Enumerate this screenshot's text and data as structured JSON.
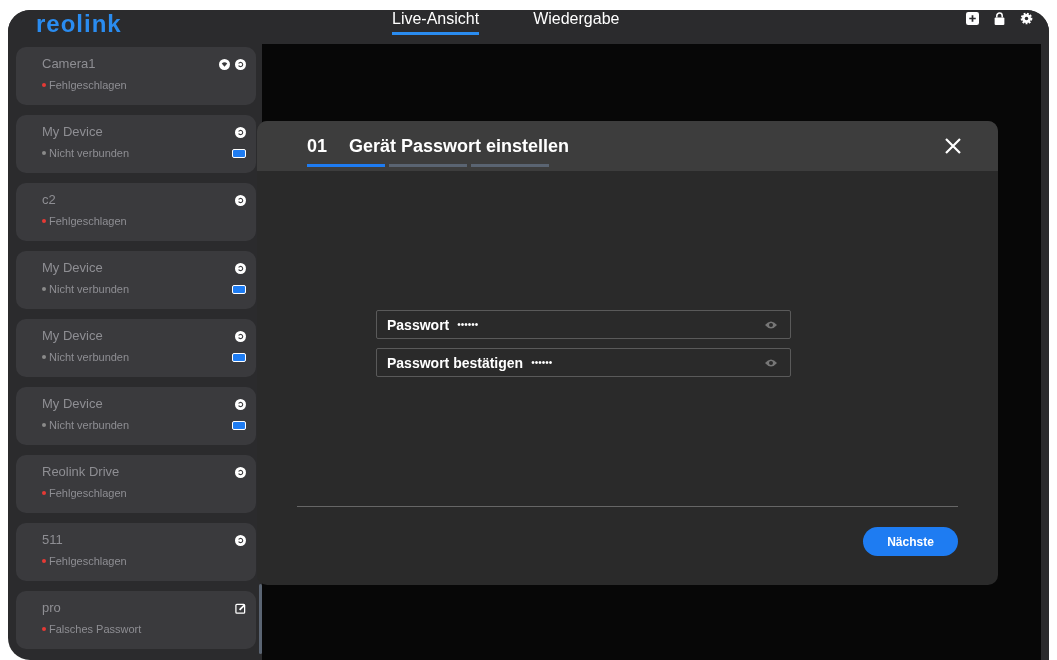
{
  "logo": "reolink",
  "tabs": [
    {
      "label": "Live-Ansicht",
      "selected": true
    },
    {
      "label": "Wiedergabe",
      "selected": false
    }
  ],
  "toolbar": [
    {
      "kind": "add"
    },
    {
      "kind": "lock"
    },
    {
      "kind": "settings"
    }
  ],
  "devices": [
    {
      "name": "Camera1",
      "status": "Fehlgeschlagen",
      "color": "#e53935",
      "icons": [
        {
          "kind": "wifi"
        },
        {
          "kind": "refresh"
        }
      ],
      "battery": false
    },
    {
      "name": "My Device",
      "status": "Nicht verbunden",
      "color": "#8a8a8a",
      "icons": [
        {
          "kind": "refresh"
        }
      ],
      "battery": true
    },
    {
      "name": "c2",
      "status": "Fehlgeschlagen",
      "color": "#e53935",
      "icons": [
        {
          "kind": "refresh"
        }
      ],
      "battery": false
    },
    {
      "name": "My Device",
      "status": "Nicht verbunden",
      "color": "#8a8a8a",
      "icons": [
        {
          "kind": "refresh"
        }
      ],
      "battery": true
    },
    {
      "name": "My Device",
      "status": "Nicht verbunden",
      "color": "#8a8a8a",
      "icons": [
        {
          "kind": "refresh"
        }
      ],
      "battery": true
    },
    {
      "name": "My Device",
      "status": "Nicht verbunden",
      "color": "#8a8a8a",
      "icons": [
        {
          "kind": "refresh"
        }
      ],
      "battery": true
    },
    {
      "name": "Reolink Drive",
      "status": "Fehlgeschlagen",
      "color": "#e53935",
      "icons": [
        {
          "kind": "refresh"
        }
      ],
      "battery": false
    },
    {
      "name": "511",
      "status": "Fehlgeschlagen",
      "color": "#e53935",
      "icons": [
        {
          "kind": "refresh"
        }
      ],
      "battery": false
    },
    {
      "name": "pro",
      "status": "Falsches Passwort",
      "color": "#e53935",
      "icons": [
        {
          "kind": "edit"
        }
      ],
      "battery": false
    }
  ],
  "dialog": {
    "step": "01",
    "title": "Gerät Passwort einstellen",
    "steps": [
      {
        "selected": true
      },
      {
        "selected": false
      },
      {
        "selected": false
      }
    ],
    "fields": [
      {
        "label": "Passwort",
        "value": "••••••"
      },
      {
        "label": "Passwort bestätigen",
        "value": "••••••"
      }
    ],
    "button": "Nächste"
  }
}
